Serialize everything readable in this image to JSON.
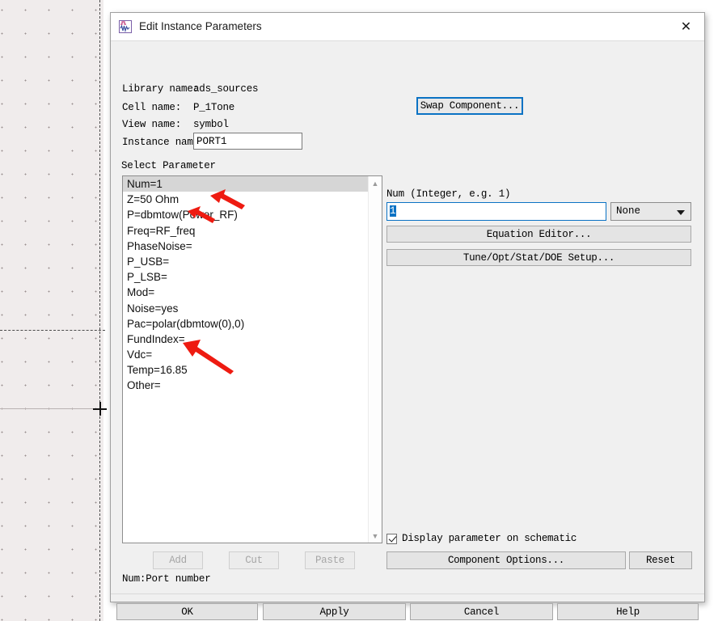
{
  "dialog": {
    "title": "Edit Instance Parameters",
    "icon": "component-symbol-icon",
    "close_icon": "close-icon"
  },
  "fields": {
    "library_label": "Library name:",
    "library_value": "ads_sources",
    "cell_label": "Cell name:",
    "cell_value": "P_1Tone",
    "view_label": "View name:",
    "view_value": "symbol",
    "instance_label": "Instance name:",
    "instance_value": "PORT1",
    "swap_button": "Swap Component..."
  },
  "select_parameter": {
    "heading": "Select Parameter",
    "items": [
      "Num=1",
      "Z=50 Ohm",
      "P=dbmtow(Power_RF)",
      "Freq=RF_freq",
      "PhaseNoise=",
      "P_USB=",
      "P_LSB=",
      "Mod=",
      "Noise=yes",
      "Pac=polar(dbmtow(0),0)",
      "FundIndex=",
      "Vdc=",
      "Temp=16.85",
      "Other="
    ],
    "selected_index": 0,
    "scroll_up_icon": "chevron-up-icon",
    "scroll_down_icon": "chevron-down-icon"
  },
  "editor": {
    "hint": "Num (Integer, e.g. 1)",
    "value": "1",
    "unit_selected": "None",
    "unit_caret_icon": "chevron-down-icon",
    "equation_editor_button": "Equation Editor...",
    "tune_setup_button": "Tune/Opt/Stat/DOE Setup...",
    "display_checkbox_label": "Display parameter on schematic",
    "display_checkbox_checked": true,
    "component_options_button": "Component Options...",
    "reset_button": "Reset"
  },
  "list_actions": {
    "add": "Add",
    "cut": "Cut",
    "paste": "Paste"
  },
  "status": {
    "hint": "Num:Port number"
  },
  "footer": {
    "ok": "OK",
    "apply": "Apply",
    "cancel": "Cancel",
    "help": "Help"
  },
  "annotations": {
    "arrow_color": "#ee1b11",
    "arrows": [
      {
        "name": "arrow-freq-upper",
        "target": "Freq=RF_freq"
      },
      {
        "name": "arrow-freq-lower",
        "target": "Freq=RF_freq"
      },
      {
        "name": "arrow-temp",
        "target": "Temp=16.85"
      }
    ]
  },
  "background": {
    "name": "schematic-canvas",
    "grid": "dot-grid"
  }
}
